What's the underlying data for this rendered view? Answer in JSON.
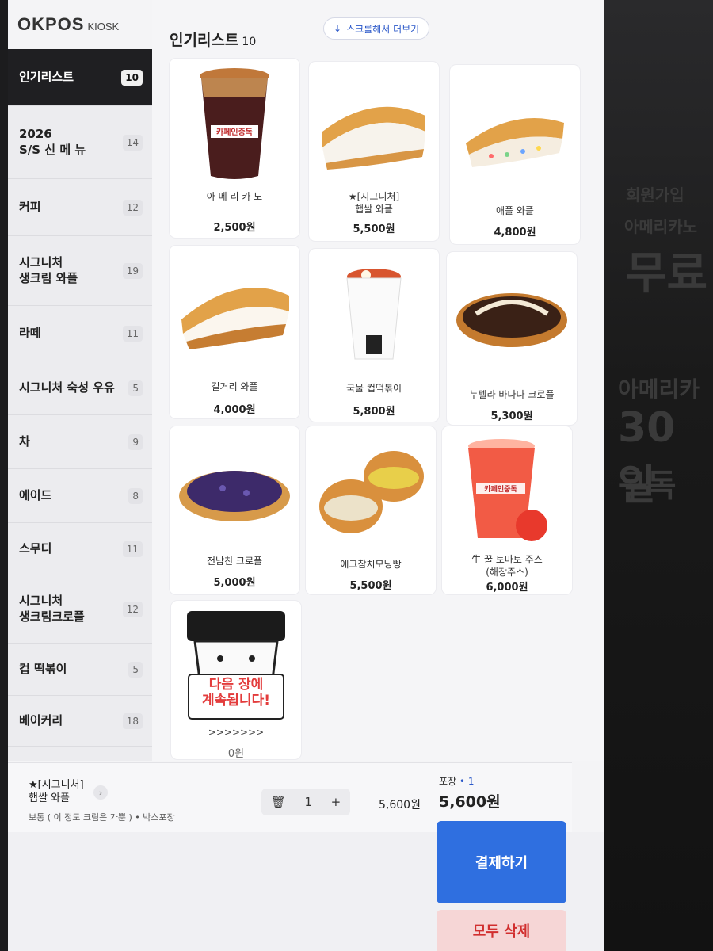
{
  "brand": {
    "name": "OKPOS",
    "sub": "KIOSK"
  },
  "sidebar": {
    "items": [
      {
        "label": "인기리스트",
        "count": "10",
        "active": true
      },
      {
        "label": "2026\nS/S 신 메 뉴",
        "count": "14"
      },
      {
        "label": "커피",
        "count": "12"
      },
      {
        "label": "시그니처\n생크림 와플",
        "count": "19"
      },
      {
        "label": "라떼",
        "count": "11"
      },
      {
        "label": "시그니처 숙성 우유",
        "count": "5"
      },
      {
        "label": "차",
        "count": "9"
      },
      {
        "label": "에이드",
        "count": "8"
      },
      {
        "label": "스무디",
        "count": "11"
      },
      {
        "label": "시그니처\n생크림크로플",
        "count": "12"
      },
      {
        "label": "컵 떡볶이",
        "count": "5"
      },
      {
        "label": "베이커리",
        "count": "18"
      }
    ]
  },
  "main": {
    "title": "인기리스트",
    "count": "10",
    "scroll_hint": "스크롤해서 더보기",
    "products": [
      {
        "name": "아 메 리 카 노",
        "price": "2,500원",
        "icon": "iced-americano-cup"
      },
      {
        "name": "★[시그니처]\n햅쌀 와플",
        "price": "5,500원",
        "icon": "cream-waffle"
      },
      {
        "name": "애플 와플",
        "price": "4,800원",
        "icon": "apple-waffle"
      },
      {
        "name": "길거리 와플",
        "price": "4,000원",
        "icon": "street-waffle"
      },
      {
        "name": "국물 컵떡볶이",
        "price": "5,800원",
        "icon": "cup-tteokbokki"
      },
      {
        "name": "누텔라 바나나 크로플",
        "price": "5,300원",
        "icon": "nutella-croffle"
      },
      {
        "name": "전남친 크로플",
        "price": "5,000원",
        "icon": "blueberry-croffle"
      },
      {
        "name": "에그참치모닝빵",
        "price": "5,500원",
        "icon": "morning-bread"
      },
      {
        "name": "生 꿀 토마토 주스\n(해장주스)",
        "price": "6,000원",
        "icon": "tomato-juice"
      },
      {
        "name": ">>>>>>>",
        "price": "0원",
        "icon": "next-page-mascot",
        "banner": "다음 장에\n계속됩니다!"
      }
    ]
  },
  "order": {
    "item_name": "★[시그니처]\n햅쌀 와플",
    "options": "보통 ( 이 정도 크림은 가뿐 ) • 박스포장",
    "quantity": "1",
    "line_price": "5,600원",
    "pack_label": "포장",
    "pack_count": "1",
    "total": "5,600원"
  },
  "actions": {
    "pay": "결제하기",
    "clear_all": "모두 삭제"
  },
  "colors": {
    "accent": "#2f6fe0",
    "danger": "#d12f2f",
    "active_tab": "#1f1f22"
  }
}
